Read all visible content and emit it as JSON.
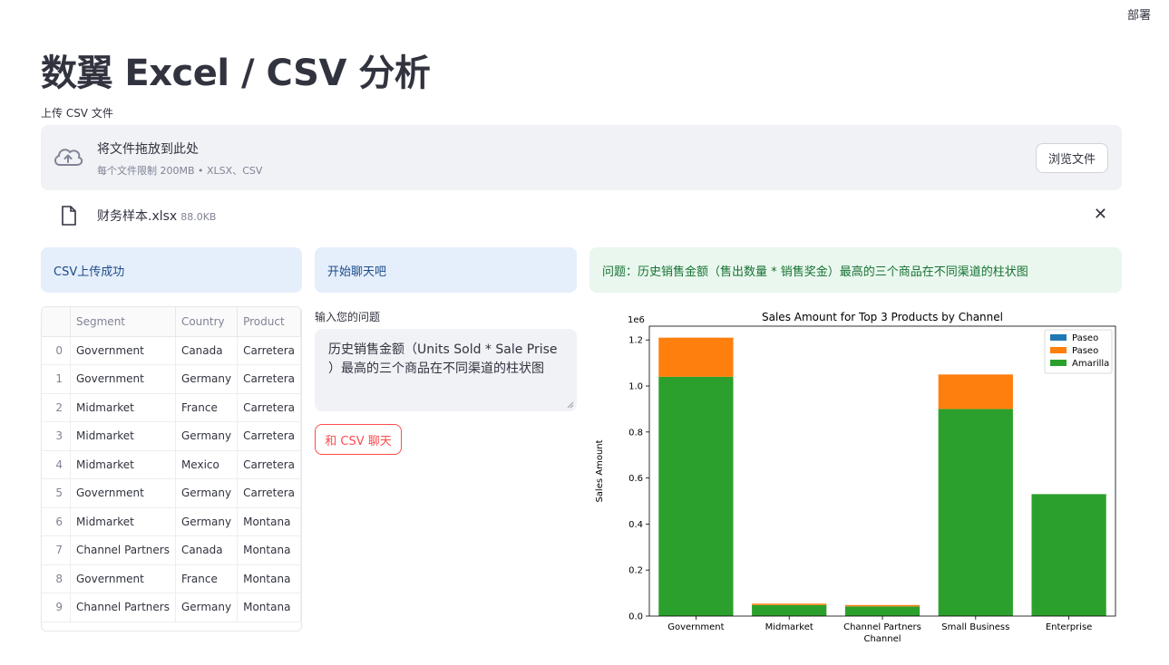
{
  "header": {
    "deploy_label": "部署"
  },
  "page_title": "数翼 Excel / CSV 分析",
  "uploader": {
    "label": "上传 CSV 文件",
    "drop_text": "将文件拖放到此处",
    "limit_text": "每个文件限制 200MB • XLSX、CSV",
    "browse_label": "浏览文件",
    "file_name": "财务样本.xlsx",
    "file_size": "88.0KB"
  },
  "status": {
    "csv_success": "CSV上传成功",
    "chat_start": "开始聊天吧",
    "question_banner": "问题：历史销售金额（售出数量 * 销售奖金）最高的三个商品在不同渠道的柱状图"
  },
  "table": {
    "columns": [
      "",
      "Segment",
      "Country",
      "Product"
    ],
    "rows": [
      [
        "0",
        "Government",
        "Canada",
        "Carretera"
      ],
      [
        "1",
        "Government",
        "Germany",
        "Carretera"
      ],
      [
        "2",
        "Midmarket",
        "France",
        "Carretera"
      ],
      [
        "3",
        "Midmarket",
        "Germany",
        "Carretera"
      ],
      [
        "4",
        "Midmarket",
        "Mexico",
        "Carretera"
      ],
      [
        "5",
        "Government",
        "Germany",
        "Carretera"
      ],
      [
        "6",
        "Midmarket",
        "Germany",
        "Montana"
      ],
      [
        "7",
        "Channel Partners",
        "Canada",
        "Montana"
      ],
      [
        "8",
        "Government",
        "France",
        "Montana"
      ],
      [
        "9",
        "Channel Partners",
        "Germany",
        "Montana"
      ]
    ]
  },
  "chat": {
    "input_label": "输入您的问题",
    "input_value": "历史销售金额（Units Sold * Sale Prise ）最高的三个商品在不同渠道的柱状图",
    "submit_label": "和 CSV 聊天"
  },
  "chart_data": {
    "type": "bar",
    "stacked": true,
    "title": "Sales Amount for Top 3 Products by Channel",
    "xlabel": "Channel",
    "ylabel": "Sales Amount",
    "y_scale_label": "1e6",
    "ylim": [
      0,
      1.26
    ],
    "yticks": [
      "0.0",
      "0.2",
      "0.4",
      "0.6",
      "0.8",
      "1.0",
      "1.2"
    ],
    "categories": [
      "Government",
      "Midmarket",
      "Channel Partners",
      "Small Business",
      "Enterprise"
    ],
    "legend_position": "top-right",
    "series": [
      {
        "name": "Paseo",
        "color": "#1f77b4",
        "values": [
          0,
          0,
          0,
          0,
          0
        ]
      },
      {
        "name": "Paseo",
        "color": "#ff7f0e",
        "values": [
          0.17,
          0.006,
          0.006,
          0.15,
          0
        ]
      },
      {
        "name": "Amarilla",
        "color": "#2ca02c",
        "values": [
          1.04,
          0.048,
          0.042,
          0.9,
          0.53
        ]
      }
    ]
  }
}
